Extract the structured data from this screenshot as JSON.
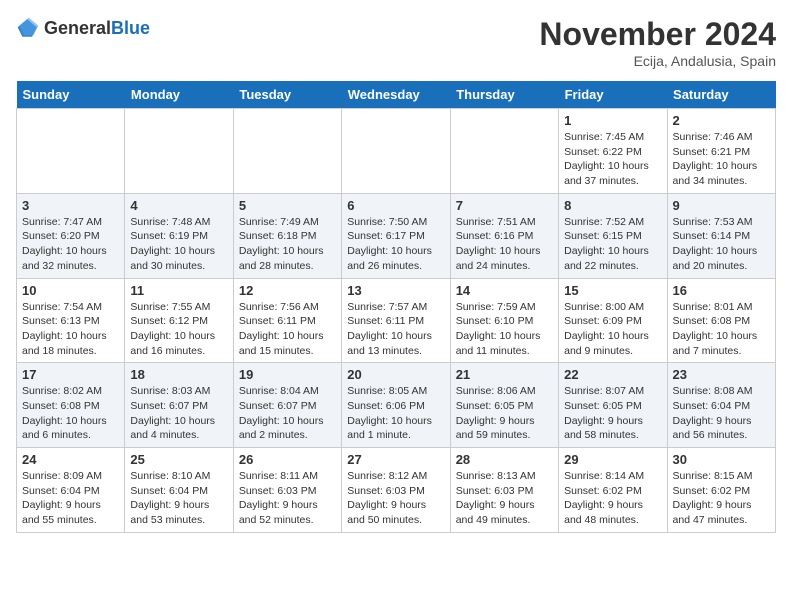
{
  "header": {
    "logo_general": "General",
    "logo_blue": "Blue",
    "title": "November 2024",
    "subtitle": "Ecija, Andalusia, Spain"
  },
  "weekdays": [
    "Sunday",
    "Monday",
    "Tuesday",
    "Wednesday",
    "Thursday",
    "Friday",
    "Saturday"
  ],
  "weeks": [
    [
      {
        "day": "",
        "info": ""
      },
      {
        "day": "",
        "info": ""
      },
      {
        "day": "",
        "info": ""
      },
      {
        "day": "",
        "info": ""
      },
      {
        "day": "",
        "info": ""
      },
      {
        "day": "1",
        "info": "Sunrise: 7:45 AM\nSunset: 6:22 PM\nDaylight: 10 hours and 37 minutes."
      },
      {
        "day": "2",
        "info": "Sunrise: 7:46 AM\nSunset: 6:21 PM\nDaylight: 10 hours and 34 minutes."
      }
    ],
    [
      {
        "day": "3",
        "info": "Sunrise: 7:47 AM\nSunset: 6:20 PM\nDaylight: 10 hours and 32 minutes."
      },
      {
        "day": "4",
        "info": "Sunrise: 7:48 AM\nSunset: 6:19 PM\nDaylight: 10 hours and 30 minutes."
      },
      {
        "day": "5",
        "info": "Sunrise: 7:49 AM\nSunset: 6:18 PM\nDaylight: 10 hours and 28 minutes."
      },
      {
        "day": "6",
        "info": "Sunrise: 7:50 AM\nSunset: 6:17 PM\nDaylight: 10 hours and 26 minutes."
      },
      {
        "day": "7",
        "info": "Sunrise: 7:51 AM\nSunset: 6:16 PM\nDaylight: 10 hours and 24 minutes."
      },
      {
        "day": "8",
        "info": "Sunrise: 7:52 AM\nSunset: 6:15 PM\nDaylight: 10 hours and 22 minutes."
      },
      {
        "day": "9",
        "info": "Sunrise: 7:53 AM\nSunset: 6:14 PM\nDaylight: 10 hours and 20 minutes."
      }
    ],
    [
      {
        "day": "10",
        "info": "Sunrise: 7:54 AM\nSunset: 6:13 PM\nDaylight: 10 hours and 18 minutes."
      },
      {
        "day": "11",
        "info": "Sunrise: 7:55 AM\nSunset: 6:12 PM\nDaylight: 10 hours and 16 minutes."
      },
      {
        "day": "12",
        "info": "Sunrise: 7:56 AM\nSunset: 6:11 PM\nDaylight: 10 hours and 15 minutes."
      },
      {
        "day": "13",
        "info": "Sunrise: 7:57 AM\nSunset: 6:11 PM\nDaylight: 10 hours and 13 minutes."
      },
      {
        "day": "14",
        "info": "Sunrise: 7:59 AM\nSunset: 6:10 PM\nDaylight: 10 hours and 11 minutes."
      },
      {
        "day": "15",
        "info": "Sunrise: 8:00 AM\nSunset: 6:09 PM\nDaylight: 10 hours and 9 minutes."
      },
      {
        "day": "16",
        "info": "Sunrise: 8:01 AM\nSunset: 6:08 PM\nDaylight: 10 hours and 7 minutes."
      }
    ],
    [
      {
        "day": "17",
        "info": "Sunrise: 8:02 AM\nSunset: 6:08 PM\nDaylight: 10 hours and 6 minutes."
      },
      {
        "day": "18",
        "info": "Sunrise: 8:03 AM\nSunset: 6:07 PM\nDaylight: 10 hours and 4 minutes."
      },
      {
        "day": "19",
        "info": "Sunrise: 8:04 AM\nSunset: 6:07 PM\nDaylight: 10 hours and 2 minutes."
      },
      {
        "day": "20",
        "info": "Sunrise: 8:05 AM\nSunset: 6:06 PM\nDaylight: 10 hours and 1 minute."
      },
      {
        "day": "21",
        "info": "Sunrise: 8:06 AM\nSunset: 6:05 PM\nDaylight: 9 hours and 59 minutes."
      },
      {
        "day": "22",
        "info": "Sunrise: 8:07 AM\nSunset: 6:05 PM\nDaylight: 9 hours and 58 minutes."
      },
      {
        "day": "23",
        "info": "Sunrise: 8:08 AM\nSunset: 6:04 PM\nDaylight: 9 hours and 56 minutes."
      }
    ],
    [
      {
        "day": "24",
        "info": "Sunrise: 8:09 AM\nSunset: 6:04 PM\nDaylight: 9 hours and 55 minutes."
      },
      {
        "day": "25",
        "info": "Sunrise: 8:10 AM\nSunset: 6:04 PM\nDaylight: 9 hours and 53 minutes."
      },
      {
        "day": "26",
        "info": "Sunrise: 8:11 AM\nSunset: 6:03 PM\nDaylight: 9 hours and 52 minutes."
      },
      {
        "day": "27",
        "info": "Sunrise: 8:12 AM\nSunset: 6:03 PM\nDaylight: 9 hours and 50 minutes."
      },
      {
        "day": "28",
        "info": "Sunrise: 8:13 AM\nSunset: 6:03 PM\nDaylight: 9 hours and 49 minutes."
      },
      {
        "day": "29",
        "info": "Sunrise: 8:14 AM\nSunset: 6:02 PM\nDaylight: 9 hours and 48 minutes."
      },
      {
        "day": "30",
        "info": "Sunrise: 8:15 AM\nSunset: 6:02 PM\nDaylight: 9 hours and 47 minutes."
      }
    ]
  ]
}
